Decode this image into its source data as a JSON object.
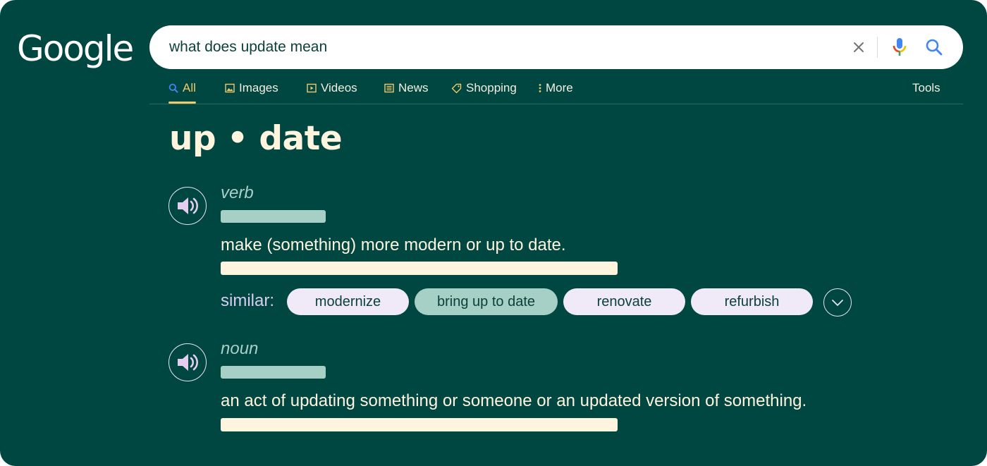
{
  "logo": {
    "text": "Google"
  },
  "search": {
    "query": "what does update mean",
    "icons": {
      "clear": "close-icon",
      "voice": "microphone-icon",
      "submit": "search-icon"
    }
  },
  "tabs": {
    "items": [
      {
        "label": "All",
        "icon": "search-icon",
        "active": true
      },
      {
        "label": "Images",
        "icon": "image-icon"
      },
      {
        "label": "Videos",
        "icon": "play-icon"
      },
      {
        "label": "News",
        "icon": "newspaper-icon"
      },
      {
        "label": "Shopping",
        "icon": "tag-icon"
      },
      {
        "label": "More",
        "icon": "more-vertical-icon"
      }
    ],
    "tools": "Tools"
  },
  "entry": {
    "headword": "up • date",
    "senses": [
      {
        "part_of_speech": "verb",
        "definition": "make (something) more modern or up to date.",
        "similar_label": "similar:",
        "similar": [
          "modernize",
          "bring up to date",
          "renovate",
          "refurbish"
        ],
        "selected_similar": "bring up to date"
      },
      {
        "part_of_speech": "noun",
        "definition": "an act of updating something or someone or an updated version of something."
      }
    ]
  },
  "colors": {
    "background": "#004741",
    "accent": "#f1c86a",
    "cream": "#fff4de",
    "mint": "#a6cfc5",
    "lavender": "#efe9f8"
  }
}
